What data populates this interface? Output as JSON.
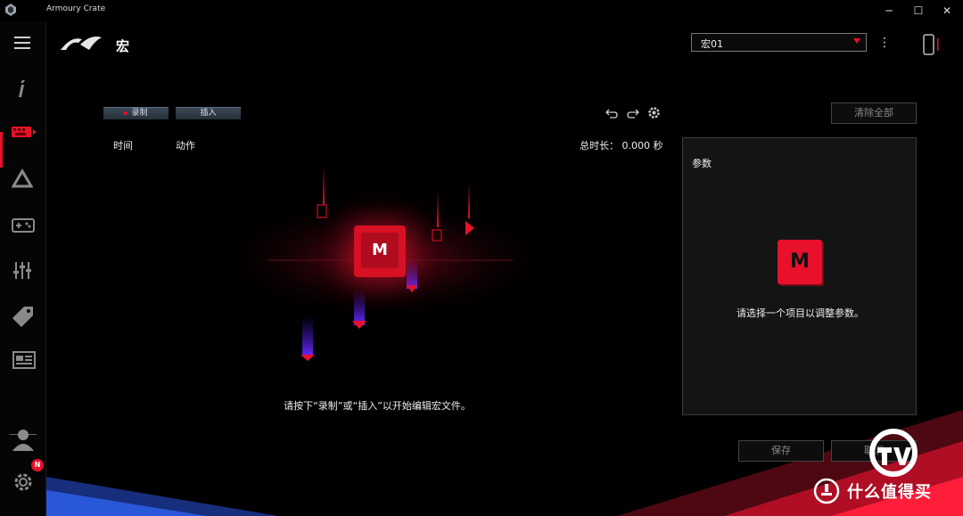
{
  "window": {
    "title": "Armoury Crate",
    "controls": {
      "minimize": "─",
      "maximize": "☐",
      "close": "✕"
    }
  },
  "rail": {
    "items": [
      {
        "name": "menu",
        "icon": "hamburger-icon"
      },
      {
        "name": "device-info",
        "icon": "info-icon"
      },
      {
        "name": "macro",
        "icon": "keyboard-macro-icon",
        "active": true
      },
      {
        "name": "aura",
        "icon": "triangle-icon"
      },
      {
        "name": "game-library",
        "icon": "gamepad-icon"
      },
      {
        "name": "settings-tuner",
        "icon": "sliders-icon"
      },
      {
        "name": "deals",
        "icon": "tag-icon"
      },
      {
        "name": "news",
        "icon": "news-icon"
      },
      {
        "name": "user",
        "icon": "user-icon"
      },
      {
        "name": "settings",
        "icon": "gear-icon"
      }
    ],
    "notification_badge": "N"
  },
  "header": {
    "page_title": "宏",
    "profile_value": "宏01"
  },
  "toolbar": {
    "record_label": "录制",
    "insert_label": "插入",
    "clear_all_label": "清除全部"
  },
  "columns": {
    "time_label": "时间",
    "action_label": "动作",
    "total_duration": "总时长：  0.000 秒"
  },
  "empty_state": {
    "hint": "请按下“录制”或“插入”以开始编辑宏文件。",
    "key_letter": "M"
  },
  "params": {
    "title": "参数",
    "key_letter": "M",
    "hint": "请选择一个项目以调整参数。"
  },
  "footer": {
    "save_label": "保存",
    "cancel_label": "取消"
  },
  "watermark": {
    "text": "什么值得买"
  },
  "colors": {
    "accent": "#e8102a",
    "background": "#000000",
    "panel": "#141414"
  }
}
